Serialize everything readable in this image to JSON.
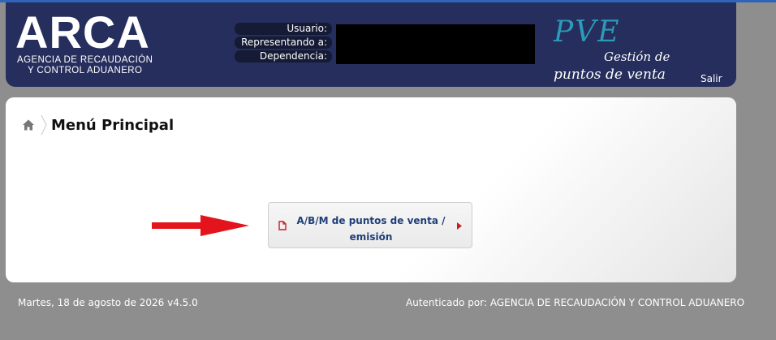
{
  "header": {
    "logo_word": "ARCA",
    "logo_sub_line1": "AGENCIA DE RECAUDACIÓN",
    "logo_sub_line2": "Y CONTROL ADUANERO",
    "user_info": {
      "usuario_label": "Usuario:",
      "representando_label": "Representando a:",
      "dependencia_label": "Dependencia:"
    },
    "app_badge": {
      "title": "PVE",
      "line1": "Gestión de",
      "line2": "puntos de venta"
    },
    "logout_label": "Salir"
  },
  "breadcrumb": {
    "icon": "home-icon",
    "title": "Menú Principal"
  },
  "menu": {
    "item_label": "A/B/M de puntos de venta / emisión",
    "item_icon": "document-icon",
    "arrow_color": "#e3141b",
    "label_color": "#1e3f78"
  },
  "footer": {
    "date_version": "Martes, 18 de agosto de 2026 v4.5.0",
    "auth_label": "Autenticado por:",
    "auth_entity": "AGENCIA DE RECAUDACIÓN Y CONTROL ADUANERO"
  },
  "colors": {
    "header_bg": "#252e5c",
    "page_bg": "#8e8e8e",
    "pve_accent": "#2c9ab8"
  }
}
